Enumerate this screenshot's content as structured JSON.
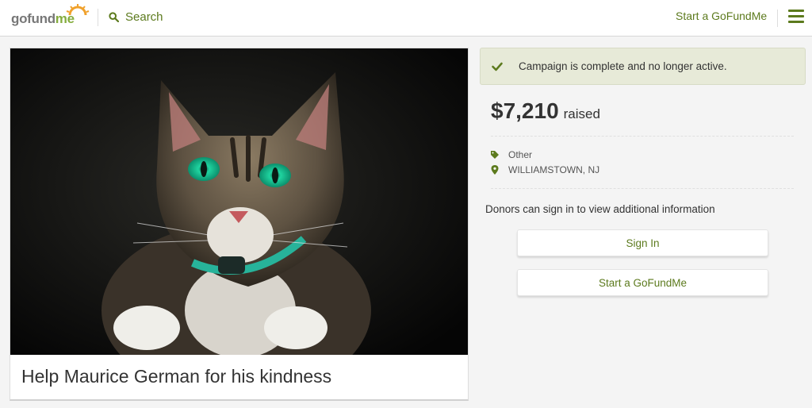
{
  "header": {
    "logo_go": "gofund",
    "logo_me": "me",
    "search_label": "Search",
    "start_link": "Start a GoFundMe"
  },
  "campaign": {
    "title": "Help Maurice German for his kindness",
    "status_banner": "Campaign is complete and no longer active.",
    "amount_raised": "$7,210",
    "raised_label": "raised",
    "category": "Other",
    "location": "WILLIAMSTOWN, NJ",
    "donors_note": "Donors can sign in to view additional information"
  },
  "buttons": {
    "sign_in": "Sign In",
    "start": "Start a GoFundMe"
  },
  "colors": {
    "brand_green": "#5c7a1d",
    "logo_orange": "#f0a12c",
    "banner_bg": "#e7ead8"
  },
  "icons": {
    "search": "search-icon",
    "menu": "hamburger-icon",
    "check": "check-icon",
    "tag": "tag-icon",
    "location": "map-pin-icon"
  }
}
